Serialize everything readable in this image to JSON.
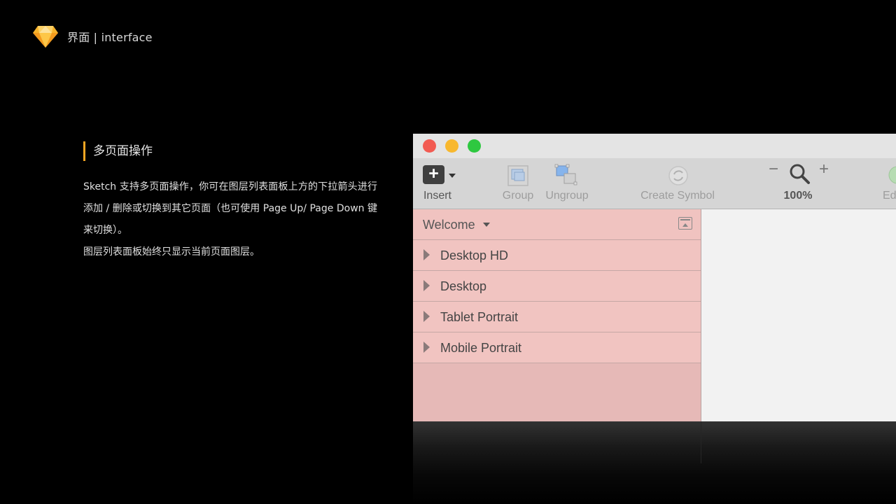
{
  "header": {
    "title": "界面 | interface",
    "logo_icon": "sketch-diamond-logo"
  },
  "section": {
    "heading": "多页面操作",
    "accent_color": "#f5a623",
    "paragraph1": "Sketch  支持多页面操作，你可在图层列表面板上方的下拉箭头进行添加 / 删除或切换到其它页面（也可使用 Page Up/ Page Down 键来切换）。",
    "paragraph2": "图层列表面板始终只显示当前页面图层。"
  },
  "app": {
    "toolbar": {
      "insert_label": "Insert",
      "group_label": "Group",
      "ungroup_label": "Ungroup",
      "create_symbol_label": "Create Symbol",
      "zoom_out": "−",
      "zoom_in": "+",
      "zoom_level": "100%",
      "edit_label": "Ed"
    },
    "sidebar": {
      "page_name": "Welcome",
      "layers": [
        {
          "label": "Desktop HD"
        },
        {
          "label": "Desktop"
        },
        {
          "label": "Tablet Portrait"
        },
        {
          "label": "Mobile Portrait"
        }
      ]
    }
  }
}
